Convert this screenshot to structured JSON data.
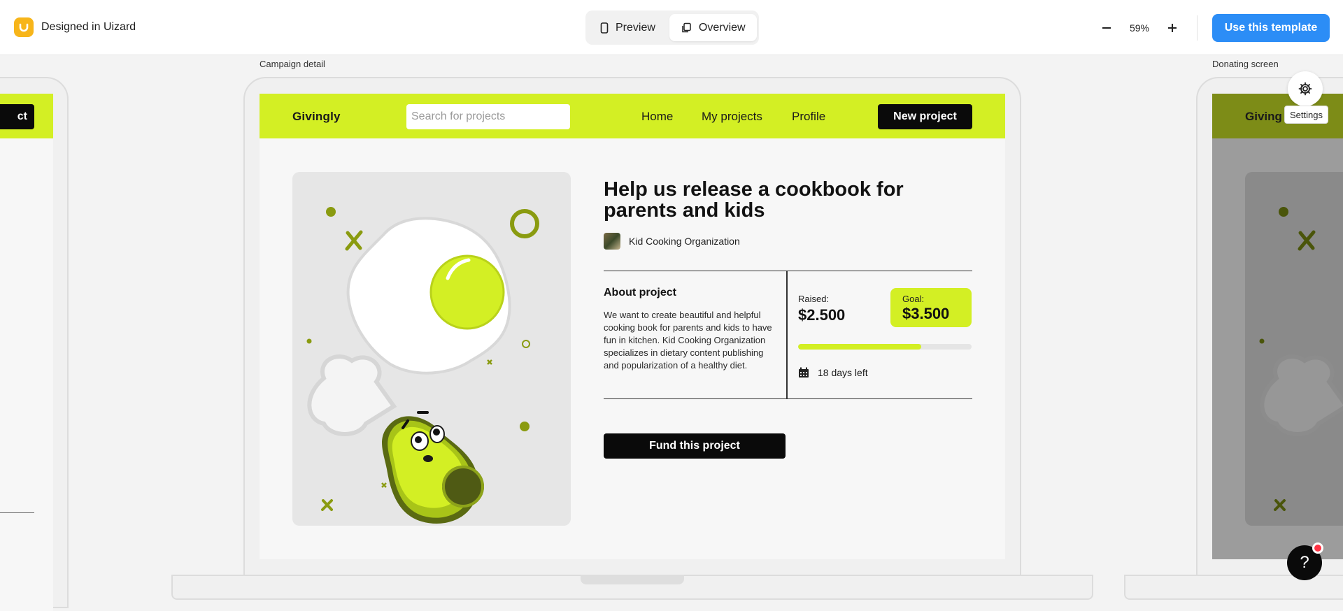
{
  "topbar": {
    "brand": "Designed in Uizard",
    "tabs": [
      {
        "label": "Preview",
        "icon": "phone-icon",
        "active": false
      },
      {
        "label": "Overview",
        "icon": "copy-pages-icon",
        "active": true
      }
    ],
    "zoom": "59%",
    "cta": "Use this template"
  },
  "frames": {
    "left_partial_button": "ct",
    "center_label": "Campaign detail",
    "right_label": "Donating screen",
    "right_partial_logo": "Giving"
  },
  "app": {
    "logo": "Givingly",
    "search_placeholder": "Search for projects",
    "nav": [
      "Home",
      "My projects",
      "Profile"
    ],
    "new_project": "New project",
    "title": "Help us release a cookbook for parents and kids",
    "organization": "Kid Cooking Organization",
    "about_heading": "About project",
    "about_text": "We want to create beautiful and helpful cooking book for parents and kids to have fun in kitchen. Kid Cooking Organization specializes in dietary content publishing and popularization of a healthy diet.",
    "raised_label": "Raised:",
    "raised_value": "$2.500",
    "goal_label": "Goal:",
    "goal_value": "$3.500",
    "progress_fraction": 0.71,
    "days_left": "18 days left",
    "fund_button": "Fund this project"
  },
  "overlay": {
    "settings_tooltip": "Settings",
    "help_label": "?"
  },
  "colors": {
    "accent": "#d3ef24",
    "cta_blue": "#2c8df6",
    "brand_yellow": "#f7b51a"
  }
}
